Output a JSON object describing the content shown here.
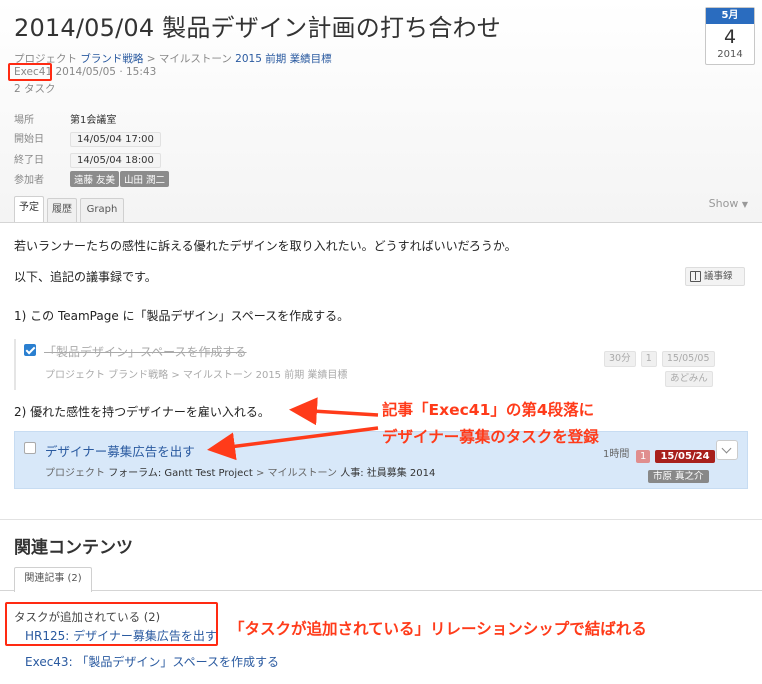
{
  "header": {
    "title": "2014/05/04 製品デザイン計画の打ち合わせ",
    "breadcrumb": {
      "label": "プロジェクト",
      "project": "ブランド戦略",
      "sep1": ">",
      "milestone_label": "マイルストーン",
      "milestone": "2015 前期 業績目標"
    },
    "entry_id": "Exec41",
    "modified": "2014/05/05 · 15:43",
    "task_count": "2 タスク"
  },
  "calendar": {
    "month": "5月",
    "day": "4",
    "year": "2014"
  },
  "fields": {
    "location_label": "場所",
    "location_value": "第1会議室",
    "start_label": "開始日",
    "start_value": "14/05/04 17:00",
    "end_label": "終了日",
    "end_value": "14/05/04 18:00",
    "attendees_label": "参加者",
    "attendees": [
      "遠藤 友美",
      "山田 潤二"
    ]
  },
  "tabs": [
    "予定",
    "履歴",
    "Graph"
  ],
  "show_menu": "Show",
  "content": {
    "para1": "若いランナーたちの感性に訴える優れたデザインを取り入れたい。どうすればいいだろうか。",
    "para2": "以下、追記の議事録です。",
    "minutes_button": "議事録",
    "item1": "1) この TeamPage に「製品デザイン」スペースを作成する。",
    "item2": "2) 優れた感性を持つデザイナーを雇い入れる。"
  },
  "task_done": {
    "title": "「製品デザイン」スペースを作成する",
    "crumbs": "プロジェクト ブランド戦略 > マイルストーン 2015 前期 業績目標",
    "estimate": "30分",
    "count": "1",
    "due": "15/05/05",
    "assignee": "あどみん"
  },
  "task_open": {
    "title": "デザイナー募集広告を出す",
    "crumbs_pre": "プロジェクト",
    "project": "フォーラム: Gantt Test Project",
    "crumbs_mid": "> マイルストーン",
    "milestone": "人事: 社員募集 2014",
    "estimate": "1時間",
    "count": "1",
    "due": "15/05/24",
    "assignee": "市原 真之介"
  },
  "annotations": {
    "line1": "記事「Exec41」の第4段落に",
    "line2": "デザイナー募集のタスクを登録",
    "line3": "「タスクが追加されている」リレーションシップで結ばれる"
  },
  "related": {
    "title": "関連コンテンツ",
    "tab": "関連記事 (2)",
    "group_label": "タスクが追加されている (2)",
    "items": [
      "HR125: デザイナー募集広告を出す",
      "Exec43: 「製品デザイン」スペースを作成する"
    ]
  },
  "colors": {
    "accent_blue": "#2a6cbf",
    "link": "#2a5aa0",
    "annotation_red": "#ff3b1a",
    "task_highlight": "#d8e8f9",
    "due_red": "#a8201c"
  }
}
